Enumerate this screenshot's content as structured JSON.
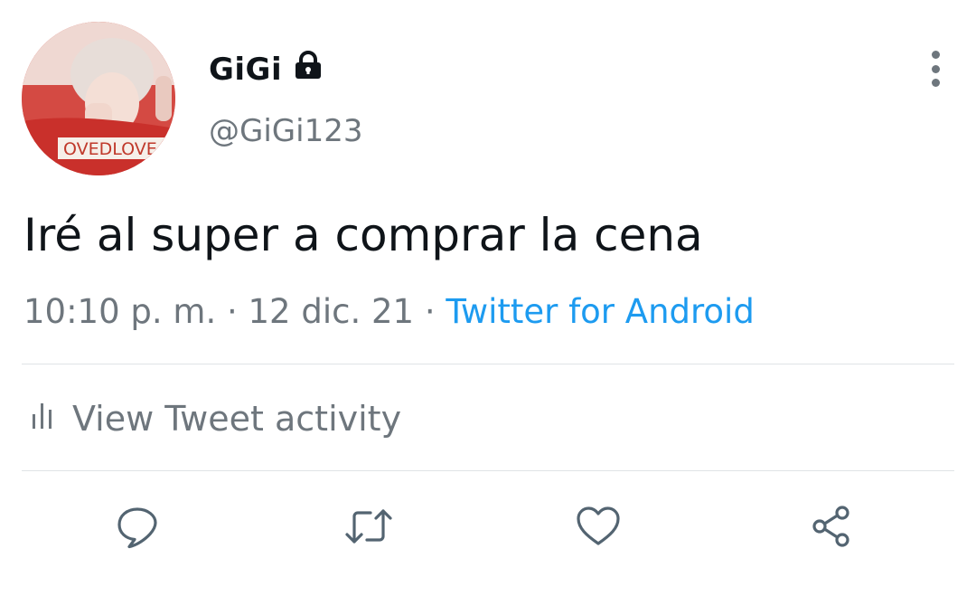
{
  "author": {
    "display_name": "GiGi",
    "handle": "@GiGi123",
    "avatar_text": "OVEDLOVE",
    "protected_icon": "lock-icon"
  },
  "tweet": {
    "text": "Iré al super a comprar la cena",
    "time": "10:10 p. m.",
    "date": "12 dic. 21",
    "separator": "·",
    "source": "Twitter for Android"
  },
  "activity": {
    "label": "View Tweet activity",
    "icon": "bar-chart-icon"
  },
  "actions": [
    {
      "name": "reply",
      "icon": "reply-icon"
    },
    {
      "name": "retweet",
      "icon": "retweet-icon"
    },
    {
      "name": "like",
      "icon": "heart-icon"
    },
    {
      "name": "share",
      "icon": "share-icon"
    }
  ],
  "colors": {
    "text": "#0f1419",
    "secondary": "#6e767d",
    "link": "#1d9bf0",
    "divider": "#dfe3e6",
    "icon": "#536471"
  }
}
